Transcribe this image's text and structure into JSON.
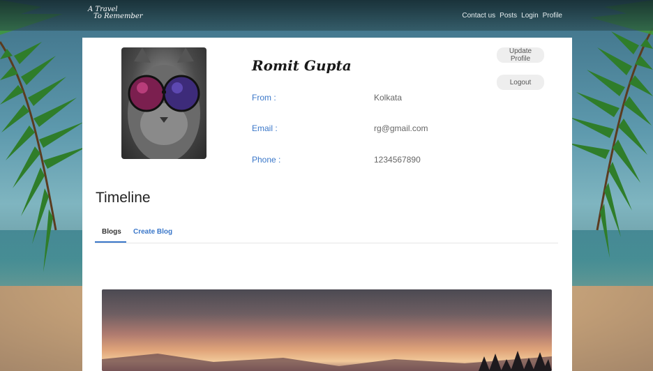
{
  "navbar": {
    "brand_line1": "A Travel",
    "brand_line2": "To Remember",
    "links": [
      "Contact us",
      "Posts",
      "Login",
      "Profile"
    ]
  },
  "profile": {
    "name": "Romit Gupta",
    "fields": [
      {
        "label": "From :",
        "value": "Kolkata"
      },
      {
        "label": "Email :",
        "value": "rg@gmail.com"
      },
      {
        "label": "Phone :",
        "value": "1234567890"
      }
    ],
    "update_button": "Update Profile",
    "logout_button": "Logout"
  },
  "timeline": {
    "title": "Timeline",
    "tabs": [
      "Blogs",
      "Create Blog"
    ],
    "active_tab": "Blogs"
  },
  "colors": {
    "accent": "#3a77c9",
    "card_bg": "#ffffff"
  }
}
